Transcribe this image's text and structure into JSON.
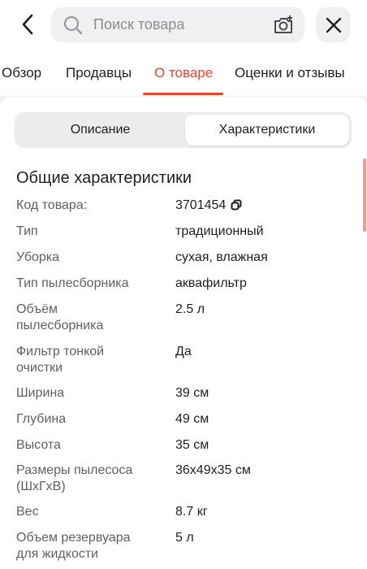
{
  "search": {
    "placeholder": "Поиск товара"
  },
  "icons": {
    "back": "chevron-left-icon",
    "search": "search-icon",
    "camera": "camera-search-icon",
    "close": "close-icon",
    "copy": "copy-icon"
  },
  "tabs": [
    {
      "label": "Обзор",
      "active": false
    },
    {
      "label": "Продавцы",
      "active": false
    },
    {
      "label": "О товаре",
      "active": true
    },
    {
      "label": "Оценки и отзывы",
      "active": false
    }
  ],
  "segments": [
    {
      "label": "Описание",
      "selected": false
    },
    {
      "label": "Характеристики",
      "selected": true
    }
  ],
  "section_title": "Общие характеристики",
  "specs": [
    {
      "label": "Код товара:",
      "value": "3701454"
    },
    {
      "label": "Тип",
      "value": "традиционный"
    },
    {
      "label": "Уборка",
      "value": "сухая, влажная"
    },
    {
      "label": "Тип пылесборника",
      "value": "аквафильтр"
    },
    {
      "label": "Объём пылесборника",
      "value": "2.5 л"
    },
    {
      "label": "Фильтр тонкой очистки",
      "value": "Да"
    },
    {
      "label": "Ширина",
      "value": "39 см"
    },
    {
      "label": "Глубина",
      "value": "49 см"
    },
    {
      "label": "Высота",
      "value": "35 см"
    },
    {
      "label": "Размеры пылесоса (ШхГхВ)",
      "value": "36x49x35 см"
    },
    {
      "label": "Вес",
      "value": "8.7 кг"
    },
    {
      "label": "Объем резервуара для жидкости",
      "value": "5 л"
    }
  ],
  "colors": {
    "accent": "#e9452f",
    "label": "#5f5f66",
    "text": "#1f1f1f"
  }
}
